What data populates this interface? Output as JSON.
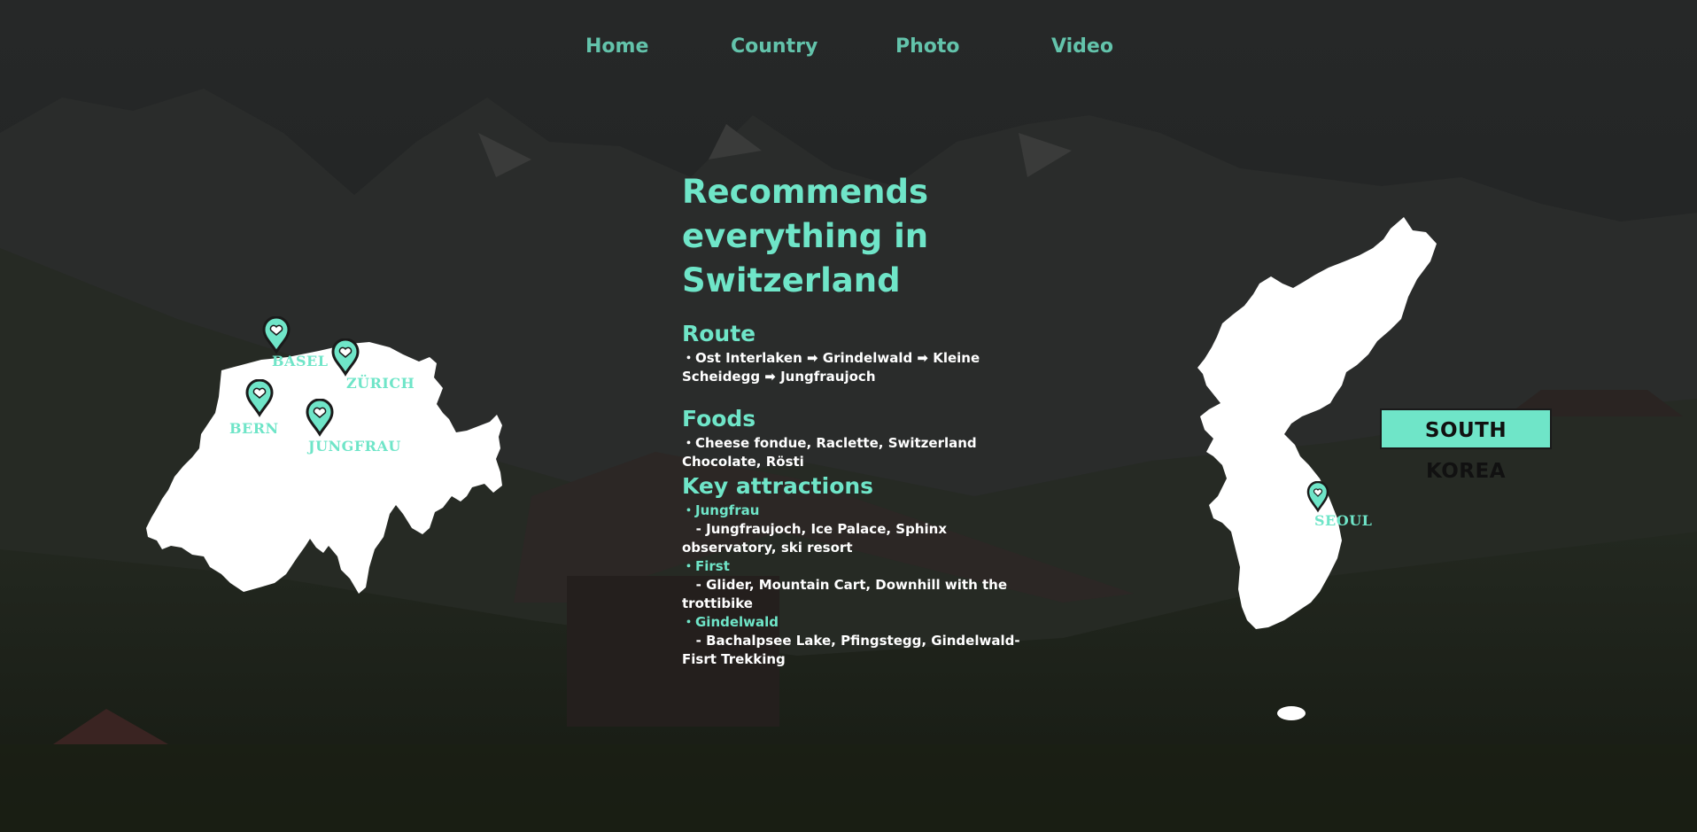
{
  "nav": {
    "items": [
      {
        "label": "Home"
      },
      {
        "label": "Country"
      },
      {
        "label": "Photo"
      },
      {
        "label": "Video"
      }
    ]
  },
  "headline": {
    "lines": [
      "Recommends",
      "everything in",
      "Switzerland"
    ]
  },
  "route": {
    "title": "Route",
    "text": "・Ost Interlaken ➡ Grindelwald ➡ Kleine Scheidegg ➡ Jungfraujoch"
  },
  "foods": {
    "title": "Foods",
    "text": "・Cheese fondue, Raclette, Switzerland Chocolate, Rösti"
  },
  "attractions": {
    "title": "Key attractions",
    "items": [
      {
        "name": "・Jungfrau",
        "detail": "   - Jungfraujoch, Ice Palace, Sphinx observatory, ski resort"
      },
      {
        "name": "・First",
        "detail": "   - Glider, Mountain Cart, Downhill with the trottibike"
      },
      {
        "name": "・Gindelwald",
        "detail": "   - Bachalpsee Lake, Pfingstegg, Gindelwald-Fisrt Trekking"
      }
    ]
  },
  "swiss_map": {
    "labels": {
      "basel": "BASEL",
      "zurich": "ZÜRICH",
      "bern": "BERN",
      "jungfrau": "JUNGFRAU"
    }
  },
  "korea_map": {
    "badge": "SOUTH KOREA",
    "city": "SEOUL"
  },
  "colors": {
    "accent": "#6fe5c8",
    "nav": "#63c3ab",
    "background": "#1f2220"
  }
}
